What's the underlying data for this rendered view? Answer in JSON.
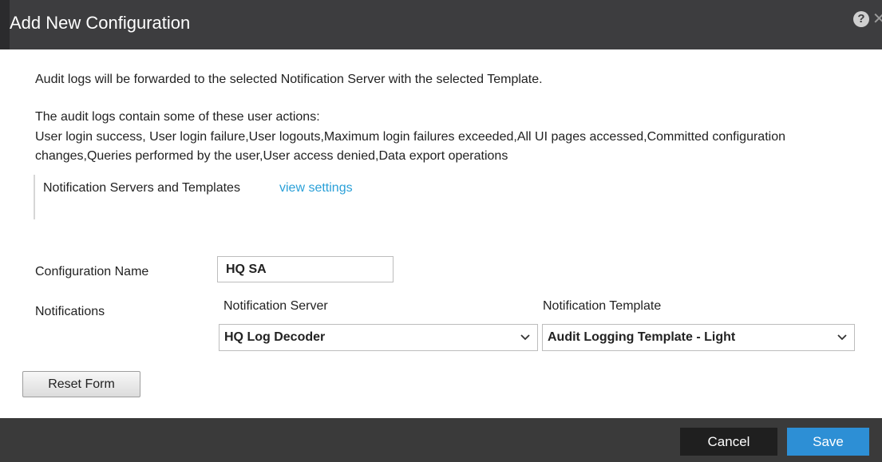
{
  "dialog": {
    "title": "Add New Configuration",
    "icons": {
      "help": "help-icon",
      "close": "close-icon"
    }
  },
  "content": {
    "intro": "Audit logs will be forwarded to the selected Notification Server with the selected Template.",
    "actions_heading": "The audit logs contain some of these user actions:",
    "actions_list": "User login success, User login failure,User logouts,Maximum login failures exceeded,All UI pages accessed,Committed configuration changes,Queries performed by the user,User access denied,Data export operations",
    "settings": {
      "label": "Notification Servers and Templates",
      "link": "view settings"
    }
  },
  "form": {
    "config_name_label": "Configuration Name",
    "config_name_value": "HQ SA",
    "notifications_label": "Notifications",
    "server_label": "Notification Server",
    "server_value": "HQ Log Decoder",
    "template_label": "Notification Template",
    "template_value": "Audit Logging Template - Light",
    "reset_label": "Reset Form"
  },
  "footer": {
    "cancel_label": "Cancel",
    "save_label": "Save"
  },
  "colors": {
    "titlebar": "#3d3d3f",
    "footer": "#3a3a3a",
    "link": "#2aa0d8",
    "save": "#2d8fd5",
    "cancel": "#1f1f1f"
  }
}
